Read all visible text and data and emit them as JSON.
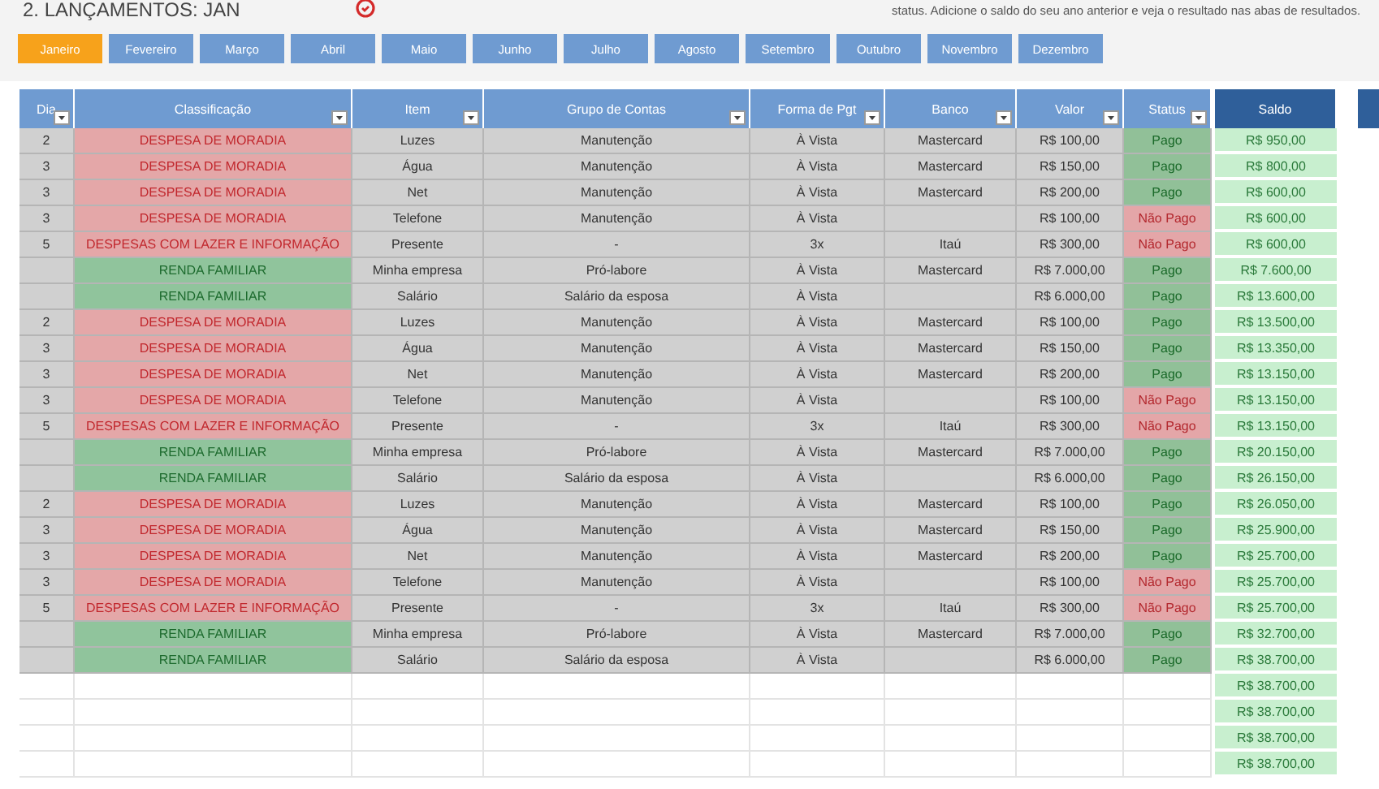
{
  "title": "2. LANÇAMENTOS: JAN",
  "description": "status. Adicione o saldo do seu ano anterior e veja o resultado nas abas de resultados.",
  "tabs": [
    {
      "label": "Janeiro",
      "selected": true
    },
    {
      "label": "Fevereiro",
      "selected": false
    },
    {
      "label": "Março",
      "selected": false
    },
    {
      "label": "Abril",
      "selected": false
    },
    {
      "label": "Maio",
      "selected": false
    },
    {
      "label": "Junho",
      "selected": false
    },
    {
      "label": "Julho",
      "selected": false
    },
    {
      "label": "Agosto",
      "selected": false
    },
    {
      "label": "Setembro",
      "selected": false
    },
    {
      "label": "Outubro",
      "selected": false
    },
    {
      "label": "Novembro",
      "selected": false
    },
    {
      "label": "Dezembro",
      "selected": false
    }
  ],
  "table": {
    "columns": [
      {
        "label": "Dia",
        "filter": true
      },
      {
        "label": "Classificação",
        "filter": true
      },
      {
        "label": "Item",
        "filter": true
      },
      {
        "label": "Grupo de Contas",
        "filter": true
      },
      {
        "label": "Forma de Pgt",
        "filter": true
      },
      {
        "label": "Banco",
        "filter": true
      },
      {
        "label": "Valor",
        "filter": true
      },
      {
        "label": "Status",
        "filter": true
      },
      {
        "label": "Saldo",
        "filter": false
      }
    ],
    "rows": [
      {
        "dia": "2",
        "classificacao": "DESPESA DE MORADIA",
        "kind": "expense",
        "item": "Luzes",
        "grupo": "Manutenção",
        "forma": "À Vista",
        "banco": "Mastercard",
        "valor": "R$ 100,00",
        "status": "Pago",
        "paid": true,
        "saldo": "R$ 950,00"
      },
      {
        "dia": "3",
        "classificacao": "DESPESA DE MORADIA",
        "kind": "expense",
        "item": "Água",
        "grupo": "Manutenção",
        "forma": "À Vista",
        "banco": "Mastercard",
        "valor": "R$ 150,00",
        "status": "Pago",
        "paid": true,
        "saldo": "R$ 800,00"
      },
      {
        "dia": "3",
        "classificacao": "DESPESA DE MORADIA",
        "kind": "expense",
        "item": "Net",
        "grupo": "Manutenção",
        "forma": "À Vista",
        "banco": "Mastercard",
        "valor": "R$ 200,00",
        "status": "Pago",
        "paid": true,
        "saldo": "R$ 600,00"
      },
      {
        "dia": "3",
        "classificacao": "DESPESA DE MORADIA",
        "kind": "expense",
        "item": "Telefone",
        "grupo": "Manutenção",
        "forma": "À Vista",
        "banco": "",
        "valor": "R$ 100,00",
        "status": "Não Pago",
        "paid": false,
        "saldo": "R$ 600,00"
      },
      {
        "dia": "5",
        "classificacao": "DESPESAS COM LAZER E INFORMAÇÃO",
        "kind": "expense",
        "item": "Presente",
        "grupo": "-",
        "forma": "3x",
        "banco": "Itaú",
        "valor": "R$ 300,00",
        "status": "Não Pago",
        "paid": false,
        "saldo": "R$ 600,00"
      },
      {
        "dia": "",
        "classificacao": "RENDA FAMILIAR",
        "kind": "income",
        "item": "Minha empresa",
        "grupo": "Pró-labore",
        "forma": "À Vista",
        "banco": "Mastercard",
        "valor": "R$ 7.000,00",
        "status": "Pago",
        "paid": true,
        "saldo": "R$ 7.600,00"
      },
      {
        "dia": "",
        "classificacao": "RENDA FAMILIAR",
        "kind": "income",
        "item": "Salário",
        "grupo": "Salário da esposa",
        "forma": "À Vista",
        "banco": "",
        "valor": "R$ 6.000,00",
        "status": "Pago",
        "paid": true,
        "saldo": "R$ 13.600,00"
      },
      {
        "dia": "2",
        "classificacao": "DESPESA DE MORADIA",
        "kind": "expense",
        "item": "Luzes",
        "grupo": "Manutenção",
        "forma": "À Vista",
        "banco": "Mastercard",
        "valor": "R$ 100,00",
        "status": "Pago",
        "paid": true,
        "saldo": "R$ 13.500,00"
      },
      {
        "dia": "3",
        "classificacao": "DESPESA DE MORADIA",
        "kind": "expense",
        "item": "Água",
        "grupo": "Manutenção",
        "forma": "À Vista",
        "banco": "Mastercard",
        "valor": "R$ 150,00",
        "status": "Pago",
        "paid": true,
        "saldo": "R$ 13.350,00"
      },
      {
        "dia": "3",
        "classificacao": "DESPESA DE MORADIA",
        "kind": "expense",
        "item": "Net",
        "grupo": "Manutenção",
        "forma": "À Vista",
        "banco": "Mastercard",
        "valor": "R$ 200,00",
        "status": "Pago",
        "paid": true,
        "saldo": "R$ 13.150,00"
      },
      {
        "dia": "3",
        "classificacao": "DESPESA DE MORADIA",
        "kind": "expense",
        "item": "Telefone",
        "grupo": "Manutenção",
        "forma": "À Vista",
        "banco": "",
        "valor": "R$ 100,00",
        "status": "Não Pago",
        "paid": false,
        "saldo": "R$ 13.150,00"
      },
      {
        "dia": "5",
        "classificacao": "DESPESAS COM LAZER E INFORMAÇÃO",
        "kind": "expense",
        "item": "Presente",
        "grupo": "-",
        "forma": "3x",
        "banco": "Itaú",
        "valor": "R$ 300,00",
        "status": "Não Pago",
        "paid": false,
        "saldo": "R$ 13.150,00"
      },
      {
        "dia": "",
        "classificacao": "RENDA FAMILIAR",
        "kind": "income",
        "item": "Minha empresa",
        "grupo": "Pró-labore",
        "forma": "À Vista",
        "banco": "Mastercard",
        "valor": "R$ 7.000,00",
        "status": "Pago",
        "paid": true,
        "saldo": "R$ 20.150,00"
      },
      {
        "dia": "",
        "classificacao": "RENDA FAMILIAR",
        "kind": "income",
        "item": "Salário",
        "grupo": "Salário da esposa",
        "forma": "À Vista",
        "banco": "",
        "valor": "R$ 6.000,00",
        "status": "Pago",
        "paid": true,
        "saldo": "R$ 26.150,00"
      },
      {
        "dia": "2",
        "classificacao": "DESPESA DE MORADIA",
        "kind": "expense",
        "item": "Luzes",
        "grupo": "Manutenção",
        "forma": "À Vista",
        "banco": "Mastercard",
        "valor": "R$ 100,00",
        "status": "Pago",
        "paid": true,
        "saldo": "R$ 26.050,00"
      },
      {
        "dia": "3",
        "classificacao": "DESPESA DE MORADIA",
        "kind": "expense",
        "item": "Água",
        "grupo": "Manutenção",
        "forma": "À Vista",
        "banco": "Mastercard",
        "valor": "R$ 150,00",
        "status": "Pago",
        "paid": true,
        "saldo": "R$ 25.900,00"
      },
      {
        "dia": "3",
        "classificacao": "DESPESA DE MORADIA",
        "kind": "expense",
        "item": "Net",
        "grupo": "Manutenção",
        "forma": "À Vista",
        "banco": "Mastercard",
        "valor": "R$ 200,00",
        "status": "Pago",
        "paid": true,
        "saldo": "R$ 25.700,00"
      },
      {
        "dia": "3",
        "classificacao": "DESPESA DE MORADIA",
        "kind": "expense",
        "item": "Telefone",
        "grupo": "Manutenção",
        "forma": "À Vista",
        "banco": "",
        "valor": "R$ 100,00",
        "status": "Não Pago",
        "paid": false,
        "saldo": "R$ 25.700,00"
      },
      {
        "dia": "5",
        "classificacao": "DESPESAS COM LAZER E INFORMAÇÃO",
        "kind": "expense",
        "item": "Presente",
        "grupo": "-",
        "forma": "3x",
        "banco": "Itaú",
        "valor": "R$ 300,00",
        "status": "Não Pago",
        "paid": false,
        "saldo": "R$ 25.700,00"
      },
      {
        "dia": "",
        "classificacao": "RENDA FAMILIAR",
        "kind": "income",
        "item": "Minha empresa",
        "grupo": "Pró-labore",
        "forma": "À Vista",
        "banco": "Mastercard",
        "valor": "R$ 7.000,00",
        "status": "Pago",
        "paid": true,
        "saldo": "R$ 32.700,00"
      },
      {
        "dia": "",
        "classificacao": "RENDA FAMILIAR",
        "kind": "income",
        "item": "Salário",
        "grupo": "Salário da esposa",
        "forma": "À Vista",
        "banco": "",
        "valor": "R$ 6.000,00",
        "status": "Pago",
        "paid": true,
        "saldo": "R$ 38.700,00"
      }
    ],
    "empty_rows": [
      {
        "saldo": "R$ 38.700,00"
      },
      {
        "saldo": "R$ 38.700,00"
      },
      {
        "saldo": "R$ 38.700,00"
      },
      {
        "saldo": "R$ 38.700,00"
      }
    ]
  }
}
